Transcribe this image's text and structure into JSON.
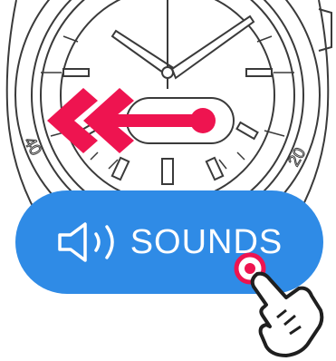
{
  "sounds_button": {
    "label": "SOUNDS",
    "icon": "speaker-icon"
  },
  "watch": {
    "bezel_numbers": [
      "40",
      "20"
    ]
  },
  "swipe_hint": {
    "icon": "swipe-left-arrow-icon",
    "direction": "left"
  },
  "tap_hint": {
    "icon": "hand-tap-icon"
  },
  "colors": {
    "button": "#2f8be6",
    "arrow": "#ee1450",
    "line": "#3a3a3a",
    "text": "#ffffff"
  }
}
